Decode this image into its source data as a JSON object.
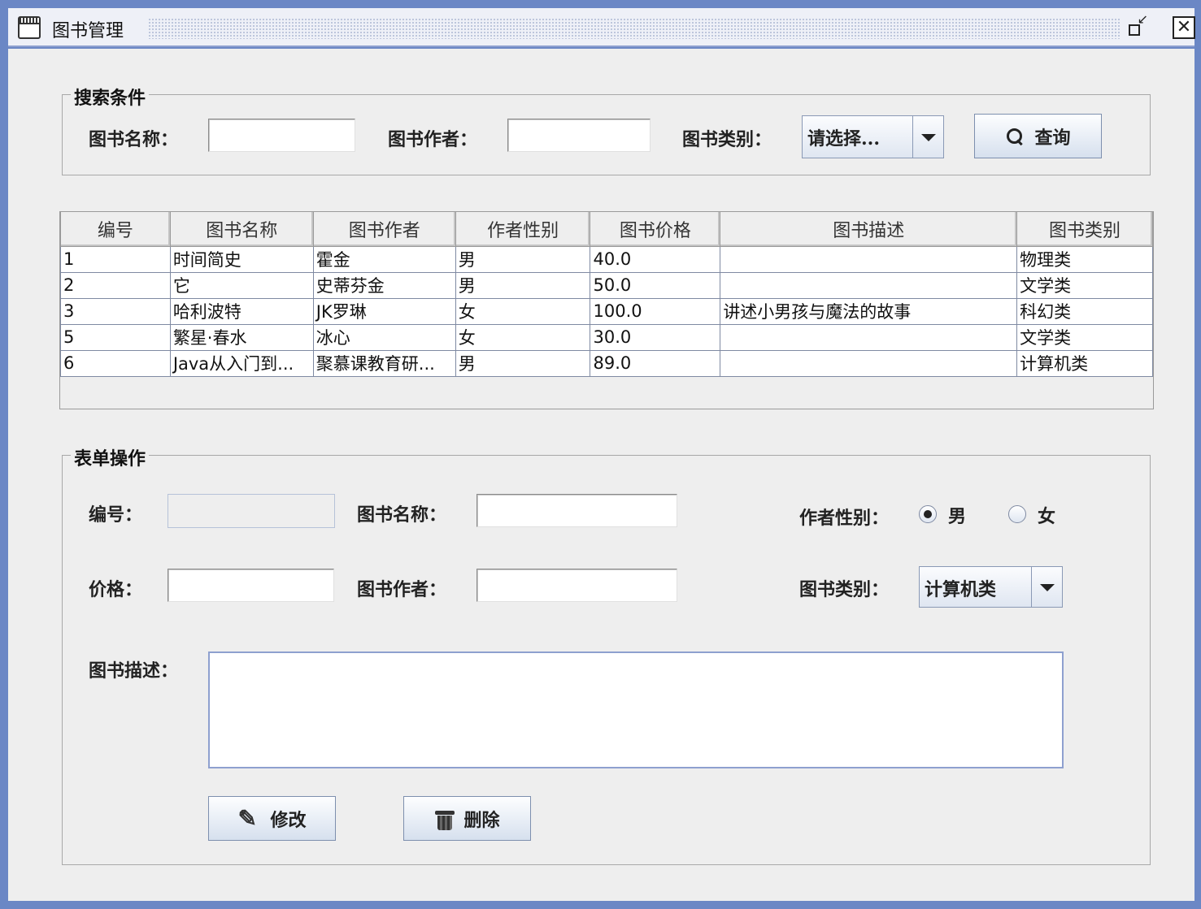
{
  "window": {
    "title": "图书管理"
  },
  "search": {
    "group_title": "搜索条件",
    "name_label": "图书名称：",
    "name_value": "",
    "author_label": "图书作者：",
    "author_value": "",
    "type_label": "图书类别：",
    "type_selected": "请选择...",
    "query_button": "查询",
    "query_icon": "search-icon"
  },
  "table": {
    "columns": [
      "编号",
      "图书名称",
      "图书作者",
      "作者性别",
      "图书价格",
      "图书描述",
      "图书类别"
    ],
    "rows": [
      [
        "1",
        "时间简史",
        "霍金",
        "男",
        "40.0",
        "",
        "物理类"
      ],
      [
        "2",
        "它",
        "史蒂芬金",
        "男",
        "50.0",
        "",
        "文学类"
      ],
      [
        "3",
        "哈利波特",
        "JK罗琳",
        "女",
        "100.0",
        "讲述小男孩与魔法的故事",
        "科幻类"
      ],
      [
        "5",
        "繁星·春水",
        "冰心",
        "女",
        "30.0",
        "",
        "文学类"
      ],
      [
        "6",
        "Java从入门到...",
        "聚慕课教育研...",
        "男",
        "89.0",
        "",
        "计算机类"
      ]
    ]
  },
  "form": {
    "group_title": "表单操作",
    "id_label": "编号：",
    "id_value": "",
    "name_label": "图书名称：",
    "name_value": "",
    "gender_label": "作者性别：",
    "gender_male": "男",
    "gender_female": "女",
    "gender_selected": "男",
    "price_label": "价格：",
    "price_value": "",
    "author_label": "图书作者：",
    "author_value": "",
    "type_label": "图书类别：",
    "type_selected": "计算机类",
    "desc_label": "图书描述：",
    "desc_value": "",
    "modify_button": "修改",
    "modify_icon": "edit-icon",
    "delete_button": "删除",
    "delete_icon": "trash-icon"
  }
}
